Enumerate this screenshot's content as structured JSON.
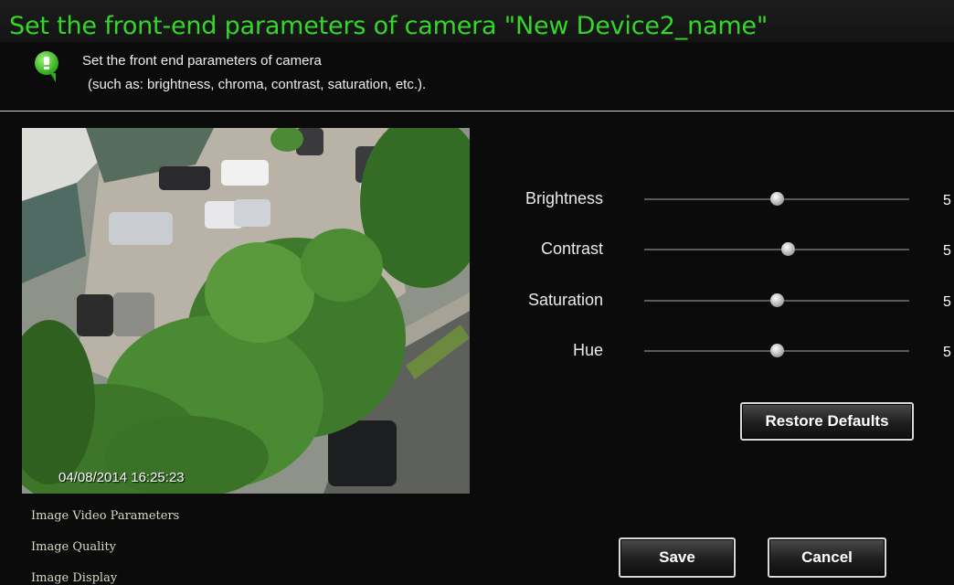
{
  "header": {
    "title": "Set the front-end parameters of camera \"New Device2_name\"",
    "description_line1": "Set the front end parameters of camera",
    "description_line2": "(such as: brightness, chroma, contrast, saturation, etc.).",
    "icon": "info-bubble-icon",
    "title_color": "#35d62a"
  },
  "preview": {
    "timestamp": "04/08/2014  16:25:23"
  },
  "menu": {
    "items": [
      "Image Video Parameters",
      "Image Quality",
      "Image Display"
    ]
  },
  "sliders": [
    {
      "label": "Brightness",
      "value": "5",
      "fraction": 0.5
    },
    {
      "label": "Contrast",
      "value": "5",
      "fraction": 0.54
    },
    {
      "label": "Saturation",
      "value": "5",
      "fraction": 0.5
    },
    {
      "label": "Hue",
      "value": "5",
      "fraction": 0.5
    }
  ],
  "buttons": {
    "restore_defaults": "Restore Defaults",
    "save": "Save",
    "cancel": "Cancel"
  }
}
